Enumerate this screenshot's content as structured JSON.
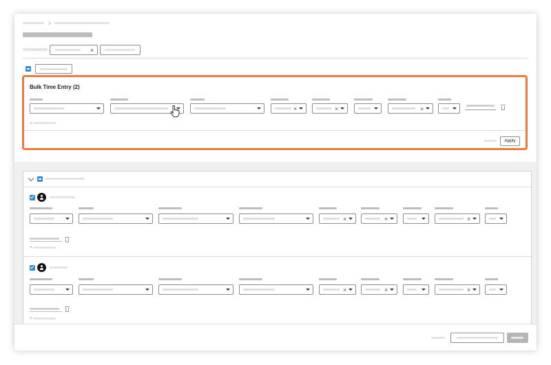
{
  "bulk_entry": {
    "title": "Bulk Time Entry (2)",
    "apply_label": "Apply"
  },
  "icons": {
    "clear": "×",
    "add": "+",
    "pointer": "hand-pointer-icon"
  },
  "colors": {
    "highlight": "#ee7b3a",
    "checkbox": "#2f8fd8",
    "primary_disabled": "#b5b5b5"
  }
}
